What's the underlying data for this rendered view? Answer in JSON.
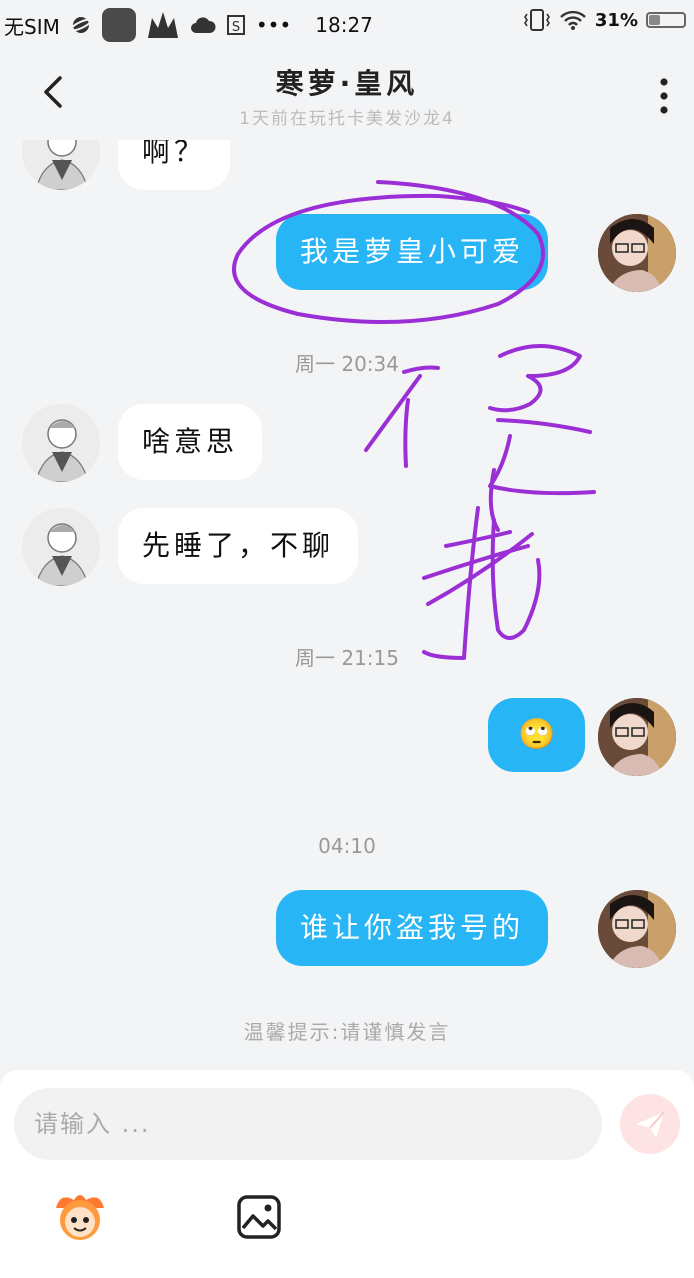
{
  "status_bar": {
    "carrier": "无SIM",
    "time": "18:27",
    "battery": "31%",
    "battery_level": 0.31,
    "dots": "•••"
  },
  "header": {
    "title": "寒萝·皇风",
    "subtitle": "1天前在玩托卡美发沙龙4"
  },
  "messages": [
    {
      "side": "in",
      "text": "啊？"
    },
    {
      "side": "out",
      "text": "我是萝皇小可爱"
    },
    {
      "side": "time",
      "text": "周一 20:34"
    },
    {
      "side": "in",
      "text": "啥意思"
    },
    {
      "side": "in",
      "text": "先睡了，不聊"
    },
    {
      "side": "time",
      "text": "周一 21:15"
    },
    {
      "side": "out",
      "text": "🙄"
    },
    {
      "side": "time",
      "text": "04:10"
    },
    {
      "side": "out",
      "text": "谁让你盗我号的"
    }
  ],
  "tip": "温馨提示:请谨慎发言",
  "input": {
    "placeholder": "请输入 ..."
  },
  "colors": {
    "accent": "#27b5f5",
    "background": "#f3f4f6",
    "annotation": "#9b2fd6"
  }
}
